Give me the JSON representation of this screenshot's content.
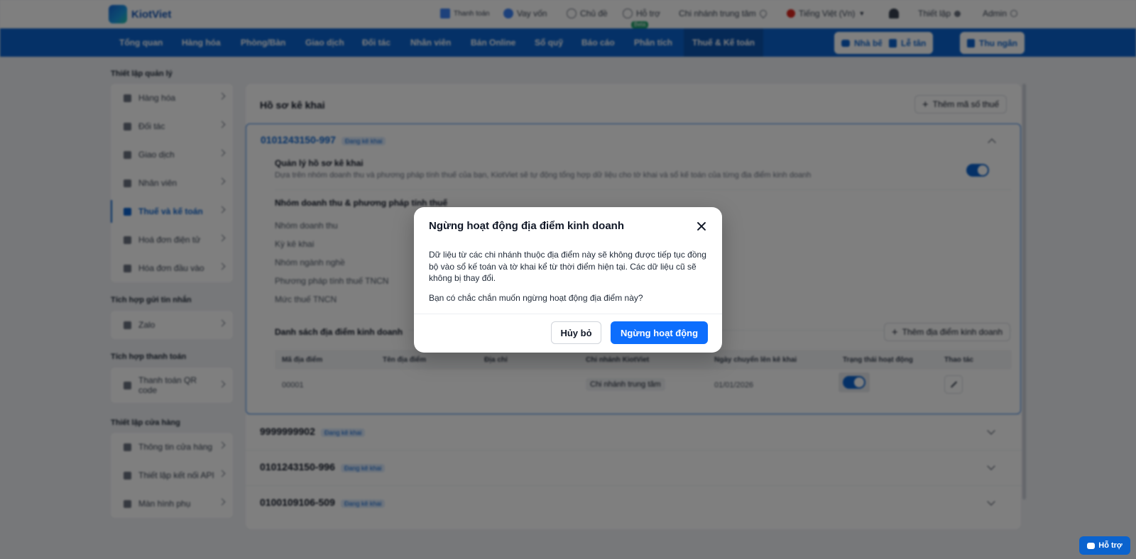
{
  "brand": {
    "name": "KiotViet"
  },
  "topbar": {
    "payment": "Thanh toán",
    "loan": "Vay vốn",
    "topics": "Chủ đề",
    "support": "Hỗ trợ",
    "support_badge": "Beta",
    "branch": "Chi nhánh trung tâm",
    "language": "Tiếng Việt (Vn)",
    "settings": "Thiết lập",
    "user": "Admin"
  },
  "nav": {
    "items": [
      "Tổng quan",
      "Hàng hóa",
      "Phòng/Bàn",
      "Giao dịch",
      "Đối tác",
      "Nhân viên",
      "Bán Online",
      "Sổ quỹ",
      "Báo cáo",
      "Phân tích",
      "Thuế & Kế toán"
    ],
    "buttons": {
      "kitchen": "Nhà bếp",
      "reception": "Lễ tân",
      "cashier": "Thu ngân"
    }
  },
  "sidebar": {
    "groups": [
      {
        "title": "Thiết lập quản lý",
        "items": [
          "Hàng hóa",
          "Đối tác",
          "Giao dịch",
          "Nhân viên",
          "Thuế và kế toán",
          "Hoá đơn điện tử",
          "Hóa đơn đầu vào"
        ]
      },
      {
        "title": "Tích hợp gửi tin nhắn",
        "items": [
          "Zalo"
        ]
      },
      {
        "title": "Tích hợp thanh toán",
        "items": [
          "Thanh toán QR code"
        ]
      },
      {
        "title": "Thiết lập cửa hàng",
        "items": [
          "Thông tin cửa hàng",
          "Thiết lập kết nối API",
          "Màn hình phụ"
        ]
      }
    ]
  },
  "main": {
    "title": "Hồ sơ kê khai",
    "add_tax_button": "Thêm mã số thuế",
    "profile": {
      "code": "0101243150-997",
      "status": "Đang kê khai",
      "manage_title": "Quản lý hồ sơ kê khai",
      "manage_desc": "Dựa trên nhóm doanh thu và phương pháp tính thuế của bạn, KiotViet sẽ tự động tổng hợp dữ liệu cho tờ khai và sổ kế toán của từng địa điểm kinh doanh",
      "group_title": "Nhóm doanh thu & phương pháp tính thuế",
      "fields": [
        "Nhóm doanh thu",
        "Kỳ kê khai",
        "Nhóm ngành nghề",
        "Phương pháp tính thuế TNCN",
        "Mức thuế TNCN"
      ],
      "locations_title": "Danh sách địa điểm kinh doanh",
      "add_location_button": "Thêm địa điểm kinh doanh",
      "table_headers": [
        "Mã địa điểm",
        "Tên địa điểm",
        "Địa chỉ",
        "Chi nhánh KiotViet",
        "Ngày chuyển lên kê khai",
        "Trạng thái hoạt động",
        "Thao tác"
      ],
      "row": {
        "code": "00001",
        "branch": "Chi nhánh trung tâm",
        "date": "01/01/2026"
      }
    },
    "other_profiles": [
      {
        "code": "9999999902",
        "status": "Đang kê khai"
      },
      {
        "code": "0101243150-996",
        "status": "Đang kê khai"
      },
      {
        "code": "0100109106-509",
        "status": "Đang kê khai"
      }
    ]
  },
  "modal": {
    "title": "Ngừng hoạt động địa điểm kinh doanh",
    "body": "Dữ liệu từ các chi nhánh thuộc địa điểm này sẽ không được tiếp tục đồng bộ vào sổ kế toán và tờ khai kể từ thời điểm hiện tại. Các dữ liệu cũ sẽ không bị thay đổi.",
    "question": "Bạn có chắc chắn muốn ngừng hoạt động địa điểm này?",
    "cancel": "Hủy bỏ",
    "confirm": "Ngừng hoạt động"
  },
  "support_fab": "Hỗ trợ",
  "colors": {
    "primary": "#0b63ce",
    "confirm": "#0d6efd",
    "overlay": "rgba(0,0,0,0.5)"
  }
}
